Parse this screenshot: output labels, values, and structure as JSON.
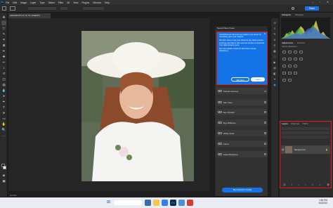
{
  "menubar": {
    "logo": "Ps",
    "items": [
      "File",
      "Edit",
      "Image",
      "Layer",
      "Type",
      "Select",
      "Filter",
      "3D",
      "View",
      "Plugins",
      "Window",
      "Help"
    ],
    "share_label": "Share"
  },
  "document": {
    "tab_title": "ADH58IUPS-IS 16.7% (RGB/8*)",
    "zoom": "16.67%",
    "status": "16.67%"
  },
  "neural_panel": {
    "title": "Neural Filters Panel",
    "tip_paragraphs": [
      "Cloud Retouch will send your photo to our server for retouching upon your request.",
      "We don't store or use your photo for any other purpose, ensuring your data is safe and your privacy is respected. Your data remains yours.",
      "For more details, check the End User License Agreement."
    ],
    "not_now_label": "Not Now",
    "agree_label": "I Agree",
    "filters": [
      "Portrait Volumes",
      "Skin Tone",
      "Eye Vessels",
      "Eye Brilliance",
      "White Teeth",
      "Fabric",
      "Clean Backdrop"
    ],
    "buy_label": "Buy Retouch Credits"
  },
  "right_panel": {
    "tabs_top": [
      "Histogram",
      "Navigator"
    ],
    "tabs_mid": [
      "Adjustments",
      "Libraries"
    ],
    "add_adjustment": "Add an adjustment",
    "layer_tabs": [
      "Layers",
      "Channels",
      "Paths"
    ],
    "layer_name": "Background"
  },
  "taskbar": {
    "time": "1:50 PM",
    "date": "5/4/2024"
  },
  "colors": {
    "accent": "#1473e6",
    "highlight_border": "#e02020"
  }
}
